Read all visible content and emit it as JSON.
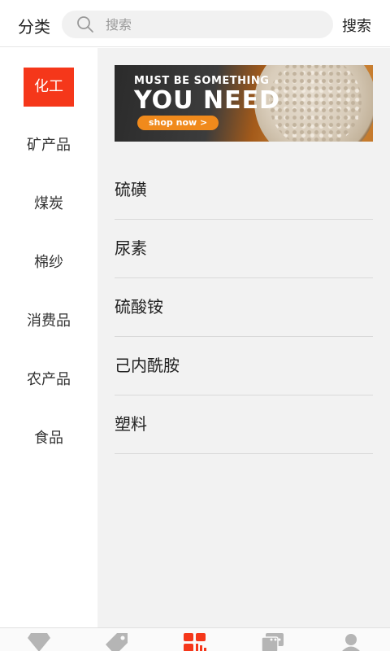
{
  "header": {
    "title": "分类",
    "search_placeholder": "搜索",
    "search_button": "搜索"
  },
  "categories": [
    {
      "label": "化工",
      "active": true
    },
    {
      "label": "矿产品",
      "active": false
    },
    {
      "label": "煤炭",
      "active": false
    },
    {
      "label": "棉纱",
      "active": false
    },
    {
      "label": "消费品",
      "active": false
    },
    {
      "label": "农产品",
      "active": false
    },
    {
      "label": "食品",
      "active": false
    }
  ],
  "banner": {
    "line1": "MUST BE SOMETHING",
    "line2": "YOU NEED",
    "cta": "shop now >"
  },
  "subcategories": [
    "硫磺",
    "尿素",
    "硫酸铵",
    "己内酰胺",
    "塑料"
  ],
  "bottom_nav": {
    "items": [
      {
        "icon": "diamond-icon",
        "active": false
      },
      {
        "icon": "tag-icon",
        "active": false
      },
      {
        "icon": "category-grid-icon",
        "active": true
      },
      {
        "icon": "message-icon",
        "active": false
      },
      {
        "icon": "user-icon",
        "active": false
      }
    ]
  },
  "colors": {
    "accent": "#f5371a",
    "inactive_icon": "#b5b5b5",
    "main_bg": "#f2f2f2"
  }
}
